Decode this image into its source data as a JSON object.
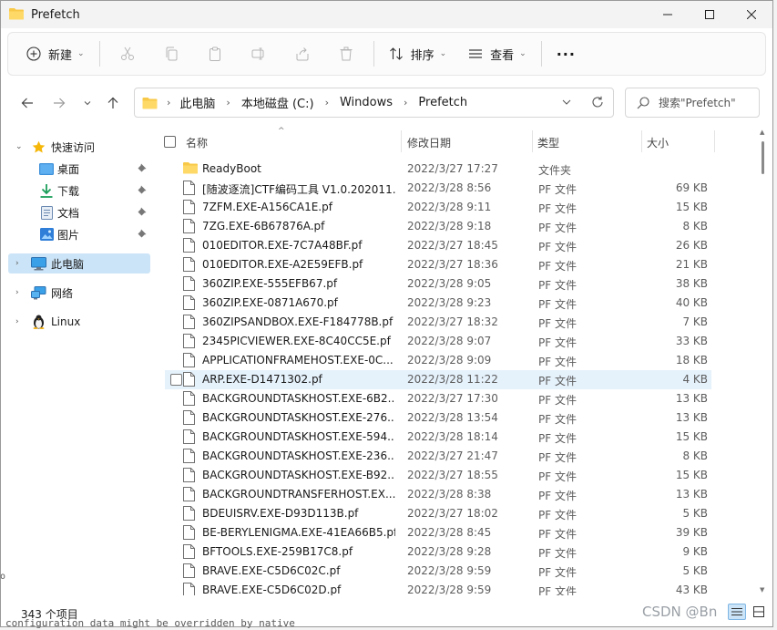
{
  "window": {
    "title": "Prefetch"
  },
  "caption": {
    "minimize": "—",
    "maximize": "☐",
    "close": "✕"
  },
  "toolbar": {
    "new_label": "新建",
    "sort_label": "排序",
    "view_label": "查看",
    "more_label": "···"
  },
  "address": {
    "crumbs": [
      "此电脑",
      "本地磁盘 (C:)",
      "Windows",
      "Prefetch"
    ]
  },
  "search": {
    "placeholder": "搜索\"Prefetch\""
  },
  "sidebar": {
    "quick_access": "快速访问",
    "items": [
      {
        "label": "桌面",
        "icon": "desktop-icon"
      },
      {
        "label": "下载",
        "icon": "download-icon"
      },
      {
        "label": "文档",
        "icon": "document-icon"
      },
      {
        "label": "图片",
        "icon": "picture-icon"
      }
    ],
    "this_pc": "此电脑",
    "network": "网络",
    "linux": "Linux"
  },
  "columns": {
    "name": "名称",
    "date": "修改日期",
    "type": "类型",
    "size": "大小"
  },
  "files": [
    {
      "name": "ReadyBoot",
      "date": "2022/3/27 17:27",
      "type": "文件夹",
      "size": "",
      "folder": true
    },
    {
      "name": "[随波逐流]CTF编码工具 V1.0.202011...",
      "date": "2022/3/28 8:56",
      "type": "PF 文件",
      "size": "69 KB"
    },
    {
      "name": "7ZFM.EXE-A156CA1E.pf",
      "date": "2022/3/28 9:11",
      "type": "PF 文件",
      "size": "15 KB"
    },
    {
      "name": "7ZG.EXE-6B67876A.pf",
      "date": "2022/3/28 9:18",
      "type": "PF 文件",
      "size": "8 KB"
    },
    {
      "name": "010EDITOR.EXE-7C7A48BF.pf",
      "date": "2022/3/27 18:45",
      "type": "PF 文件",
      "size": "26 KB"
    },
    {
      "name": "010EDITOR.EXE-A2E59EFB.pf",
      "date": "2022/3/27 18:36",
      "type": "PF 文件",
      "size": "21 KB"
    },
    {
      "name": "360ZIP.EXE-555EFB67.pf",
      "date": "2022/3/28 9:05",
      "type": "PF 文件",
      "size": "38 KB"
    },
    {
      "name": "360ZIP.EXE-0871A670.pf",
      "date": "2022/3/28 9:23",
      "type": "PF 文件",
      "size": "40 KB"
    },
    {
      "name": "360ZIPSANDBOX.EXE-F184778B.pf",
      "date": "2022/3/27 18:32",
      "type": "PF 文件",
      "size": "7 KB"
    },
    {
      "name": "2345PICVIEWER.EXE-8C40CC5E.pf",
      "date": "2022/3/28 9:07",
      "type": "PF 文件",
      "size": "33 KB"
    },
    {
      "name": "APPLICATIONFRAMEHOST.EXE-0C...",
      "date": "2022/3/28 9:09",
      "type": "PF 文件",
      "size": "18 KB"
    },
    {
      "name": "ARP.EXE-D1471302.pf",
      "date": "2022/3/28 11:22",
      "type": "PF 文件",
      "size": "4 KB",
      "hover": true
    },
    {
      "name": "BACKGROUNDTASKHOST.EXE-6B2...",
      "date": "2022/3/27 17:30",
      "type": "PF 文件",
      "size": "13 KB"
    },
    {
      "name": "BACKGROUNDTASKHOST.EXE-276...",
      "date": "2022/3/28 13:54",
      "type": "PF 文件",
      "size": "13 KB"
    },
    {
      "name": "BACKGROUNDTASKHOST.EXE-594...",
      "date": "2022/3/28 18:14",
      "type": "PF 文件",
      "size": "15 KB"
    },
    {
      "name": "BACKGROUNDTASKHOST.EXE-236...",
      "date": "2022/3/27 21:47",
      "type": "PF 文件",
      "size": "8 KB"
    },
    {
      "name": "BACKGROUNDTASKHOST.EXE-B92...",
      "date": "2022/3/27 18:55",
      "type": "PF 文件",
      "size": "15 KB"
    },
    {
      "name": "BACKGROUNDTRANSFERHOST.EX...",
      "date": "2022/3/28 8:38",
      "type": "PF 文件",
      "size": "13 KB"
    },
    {
      "name": "BDEUISRV.EXE-D93D113B.pf",
      "date": "2022/3/27 18:02",
      "type": "PF 文件",
      "size": "5 KB"
    },
    {
      "name": "BE-BERYLENIGMA.EXE-41EA66B5.pf",
      "date": "2022/3/28 8:45",
      "type": "PF 文件",
      "size": "39 KB"
    },
    {
      "name": "BFTOOLS.EXE-259B17C8.pf",
      "date": "2022/3/28 9:28",
      "type": "PF 文件",
      "size": "9 KB"
    },
    {
      "name": "BRAVE.EXE-C5D6C02C.pf",
      "date": "2022/3/28 9:59",
      "type": "PF 文件",
      "size": "5 KB"
    },
    {
      "name": "BRAVE.EXE-C5D6C02D.pf",
      "date": "2022/3/28 9:59",
      "type": "PF 文件",
      "size": "43 KB"
    }
  ],
  "status": {
    "item_count": "343 个项目"
  },
  "watermark": "CSDN @Bn",
  "background_text": "configuration data might be overridden by native",
  "background_text_left": "o",
  "colors": {
    "accent": "#0067c0",
    "folder": "#f8c948",
    "selection": "#cce4f7"
  }
}
